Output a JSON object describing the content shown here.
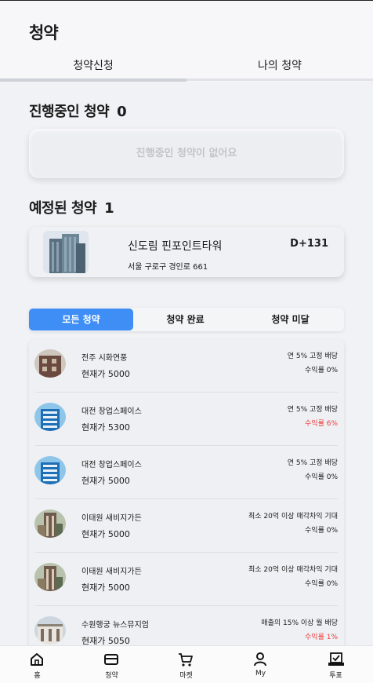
{
  "header": {
    "title": "청약"
  },
  "tabs": [
    {
      "label": "청약신청"
    },
    {
      "label": "나의 청약"
    }
  ],
  "ongoing": {
    "title": "진행중인 청약",
    "count": "0",
    "empty_text": "진행중인 청약이 없어요"
  },
  "scheduled": {
    "title": "예정된 청약",
    "count": "1",
    "item": {
      "name": "신도림 핀포인트타워",
      "address": "서울 구로구 경인로 661",
      "dday": "D+131"
    }
  },
  "filters": [
    {
      "label": "모든 청약"
    },
    {
      "label": "청약 완료"
    },
    {
      "label": "청약 미달"
    }
  ],
  "list": [
    {
      "name": "전주 시화연풍",
      "price": "현재가 5000",
      "dividend": "연 5% 고정 배당",
      "yield": "수익률 0%",
      "yield_color": "#1b1b1b",
      "icon": "building-brick"
    },
    {
      "name": "대전 창업스페이스",
      "price": "현재가 5300",
      "dividend": "연 5% 고정 배당",
      "yield": "수익률 6%",
      "yield_color": "#ee3b3b",
      "icon": "building-glass"
    },
    {
      "name": "대전 창업스페이스",
      "price": "현재가 5000",
      "dividend": "연 5% 고정 배당",
      "yield": "수익률 0%",
      "yield_color": "#1b1b1b",
      "icon": "building-glass"
    },
    {
      "name": "이태원 새비지가든",
      "price": "현재가 5000",
      "dividend": "최소 20억 이상 매각차익 기대",
      "yield": "수익률 0%",
      "yield_color": "#1b1b1b",
      "icon": "building-tower"
    },
    {
      "name": "이태원 새비지가든",
      "price": "현재가 5000",
      "dividend": "최소 20억 이상 매각차익 기대",
      "yield": "수익률 0%",
      "yield_color": "#1b1b1b",
      "icon": "building-tower"
    },
    {
      "name": "수원행궁 뉴스뮤지엄",
      "price": "현재가 5050",
      "dividend": "매출의 15% 이상 월 배당",
      "yield": "수익률 1%",
      "yield_color": "#ee3b3b",
      "icon": "building-museum"
    }
  ],
  "bottom_nav": [
    {
      "label": "홈",
      "icon": "home-icon"
    },
    {
      "label": "청약",
      "icon": "card-icon"
    },
    {
      "label": "마켓",
      "icon": "cart-icon"
    },
    {
      "label": "My",
      "icon": "person-icon"
    },
    {
      "label": "투표",
      "icon": "vote-icon"
    }
  ],
  "colors": {
    "accent": "#3e8ef6",
    "positive": "#ee3b3b"
  }
}
